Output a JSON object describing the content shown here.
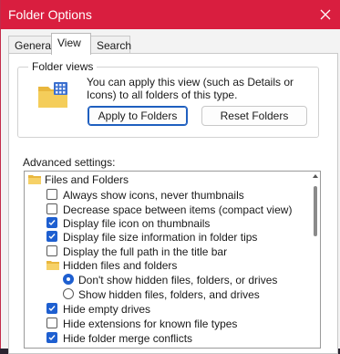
{
  "window": {
    "title": "Folder Options"
  },
  "tabs": [
    {
      "label": "General"
    },
    {
      "label": "View"
    },
    {
      "label": "Search"
    }
  ],
  "folder_views": {
    "legend": "Folder views",
    "description": "You can apply this view (such as Details or Icons) to all folders of this type.",
    "apply_button": "Apply to Folders",
    "reset_button": "Reset Folders"
  },
  "advanced": {
    "label": "Advanced settings:",
    "items": [
      {
        "label": "Files and Folders",
        "kind": "folder"
      },
      {
        "label": "Always show icons, never thumbnails",
        "kind": "checkbox",
        "checked": false
      },
      {
        "label": "Decrease space between items (compact view)",
        "kind": "checkbox",
        "checked": false
      },
      {
        "label": "Display file icon on thumbnails",
        "kind": "checkbox",
        "checked": true
      },
      {
        "label": "Display file size information in folder tips",
        "kind": "checkbox",
        "checked": true
      },
      {
        "label": "Display the full path in the title bar",
        "kind": "checkbox",
        "checked": false
      },
      {
        "label": "Hidden files and folders",
        "kind": "folder"
      },
      {
        "label": "Don't show hidden files, folders, or drives",
        "kind": "radio",
        "checked": true
      },
      {
        "label": "Show hidden files, folders, and drives",
        "kind": "radio",
        "checked": false
      },
      {
        "label": "Hide empty drives",
        "kind": "checkbox",
        "checked": true
      },
      {
        "label": "Hide extensions for known file types",
        "kind": "checkbox",
        "checked": false
      },
      {
        "label": "Hide folder merge conflicts",
        "kind": "checkbox",
        "checked": true
      }
    ]
  },
  "colors": {
    "titlebar": "#d91e3f",
    "accent": "#1e5fd0"
  }
}
